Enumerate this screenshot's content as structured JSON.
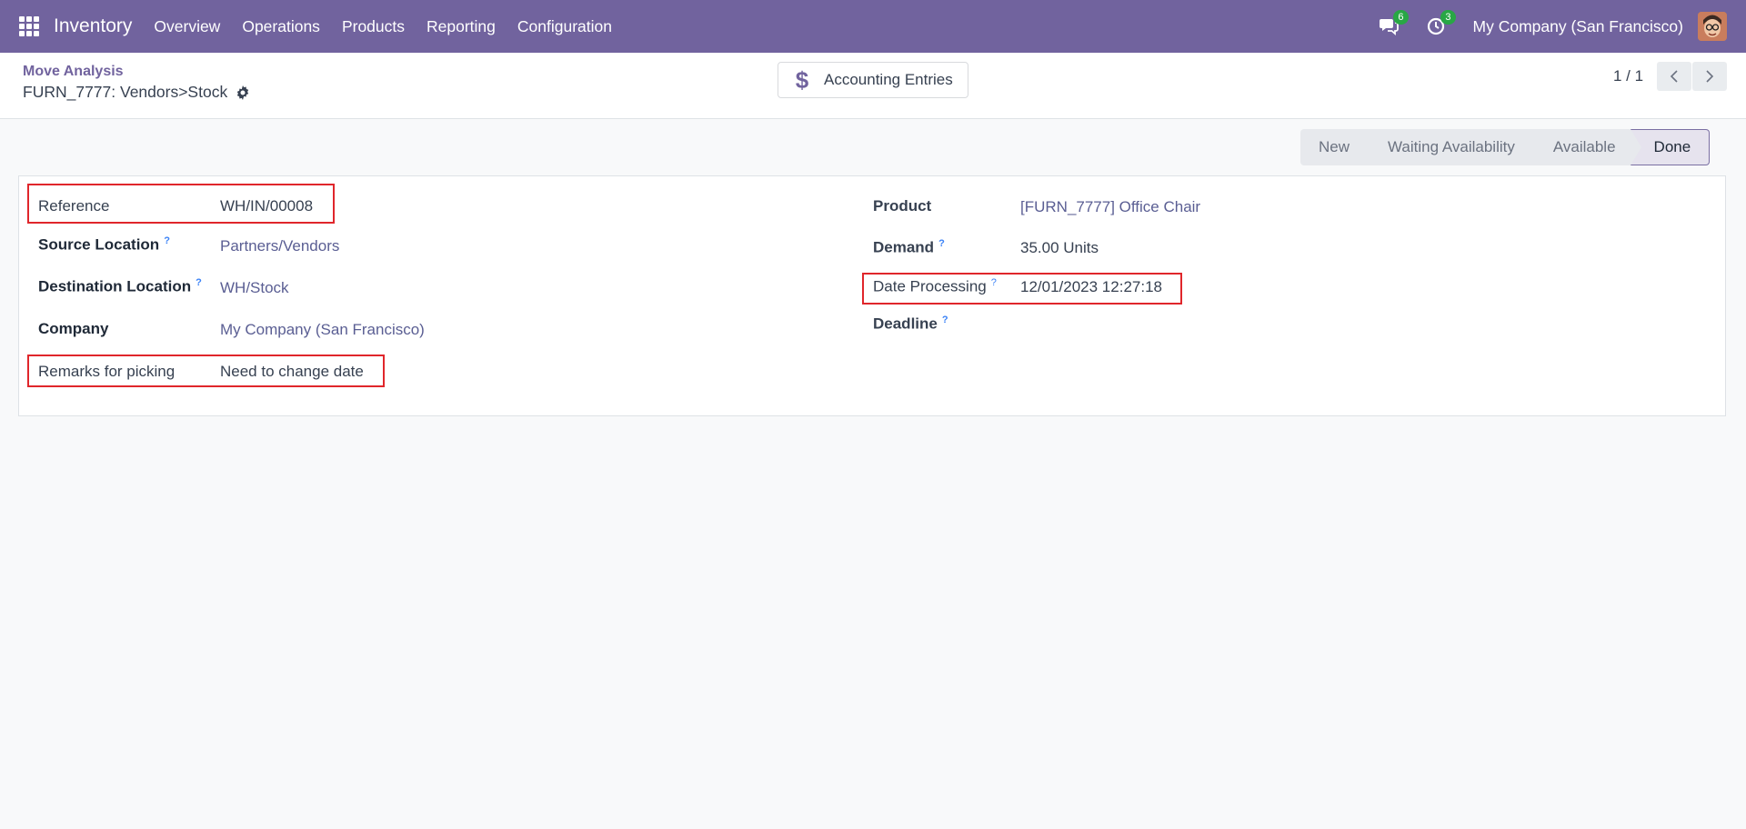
{
  "navbar": {
    "brand": "Inventory",
    "menu": [
      "Overview",
      "Operations",
      "Products",
      "Reporting",
      "Configuration"
    ],
    "messages_count": "6",
    "activities_count": "3",
    "company": "My Company (San Francisco)"
  },
  "control": {
    "breadcrumb": "Move Analysis",
    "title": "FURN_7777: Vendors>Stock",
    "smart_button": "Accounting Entries",
    "pager": "1 / 1"
  },
  "status": {
    "stages": [
      "New",
      "Waiting Availability",
      "Available",
      "Done"
    ],
    "current": "Done"
  },
  "form": {
    "left": {
      "reference_label": "Reference",
      "reference_value": "WH/IN/00008",
      "source_label": "Source Location",
      "source_value": "Partners/Vendors",
      "dest_label": "Destination Location",
      "dest_value": "WH/Stock",
      "company_label": "Company",
      "company_value": "My Company (San Francisco)",
      "remarks_label": "Remarks for picking",
      "remarks_value": "Need to change date"
    },
    "right": {
      "product_label": "Product",
      "product_value": "[FURN_7777] Office Chair",
      "demand_label": "Demand",
      "demand_value": "35.00 Units",
      "date_label": "Date Processing",
      "date_value": "12/01/2023 12:27:18",
      "deadline_label": "Deadline"
    },
    "help_mark": "?"
  },
  "colors": {
    "navbar": "#71639e",
    "highlight": "#e0262b",
    "badge": "#28a745"
  }
}
